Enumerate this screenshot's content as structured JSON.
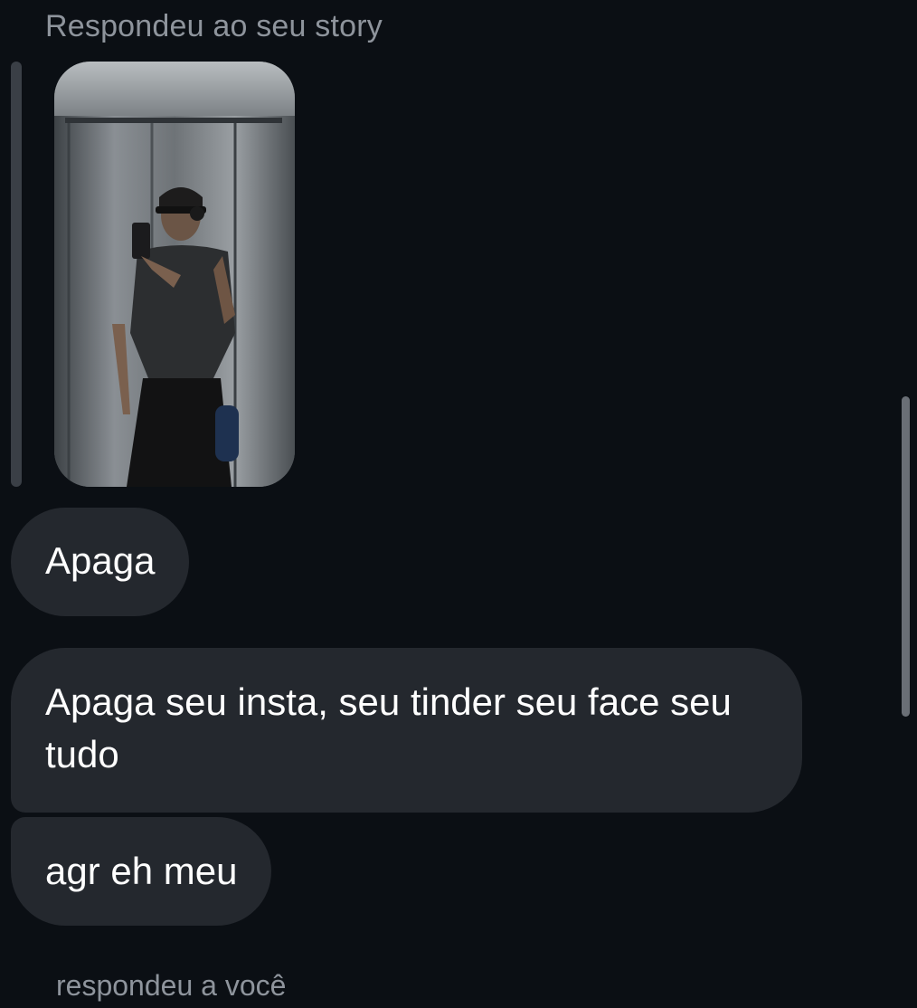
{
  "chat": {
    "story_reply_caption": "Respondeu ao seu story",
    "messages": [
      {
        "text": "Apaga"
      },
      {
        "text": "Apaga seu insta, seu tinder seu face seu tudo"
      },
      {
        "text": "agr eh meu"
      }
    ],
    "next_reply_caption": "respondeu a você"
  },
  "colors": {
    "background": "#0b0f14",
    "bubble": "#24282e",
    "caption": "#8e949c",
    "text": "#ffffff"
  },
  "icons": {
    "story_image": "elevator-mirror-selfie-photo"
  }
}
